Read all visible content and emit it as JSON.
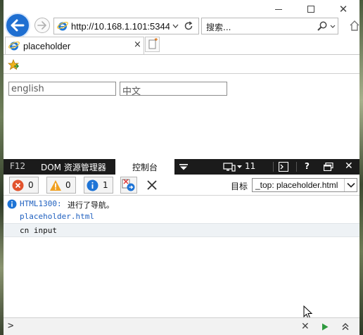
{
  "browser": {
    "address_url": "http://10.168.1.101:5344",
    "search_placeholder": "搜索...",
    "tab_title": "placeholder",
    "tab_close": "×",
    "window_close": "✕"
  },
  "icons": {
    "back": "back-arrow-icon",
    "forward": "forward-arrow-icon",
    "refresh": "refresh-icon",
    "search": "search-icon",
    "home": "home-icon",
    "favorites": "add-favorites-icon"
  },
  "page": {
    "english_input_value": "english",
    "chinese_input_value": "中文"
  },
  "devtools": {
    "f12_label": "F12",
    "dom_tab": "DOM 资源管理器",
    "console_tab": "控制台",
    "document_mode": "11",
    "help": "?",
    "close": "✕",
    "error_count": "0",
    "warning_count": "0",
    "info_count": "1",
    "target_label": "目标",
    "target_value": "_top: placeholder.html",
    "log": {
      "message_code": "HTML1300:",
      "message_text": "进行了导航。",
      "source_link": "placeholder.html",
      "output": "cn input"
    },
    "prompt": ">",
    "clear_glyph": "✕"
  },
  "colors": {
    "accent_blue": "#1f6fd1",
    "devtools_dark": "#1b1b1b",
    "error_red": "#e2532d",
    "warning_orange": "#f0a020",
    "info_blue": "#1e74d6",
    "link_blue": "#1e5fbf"
  }
}
